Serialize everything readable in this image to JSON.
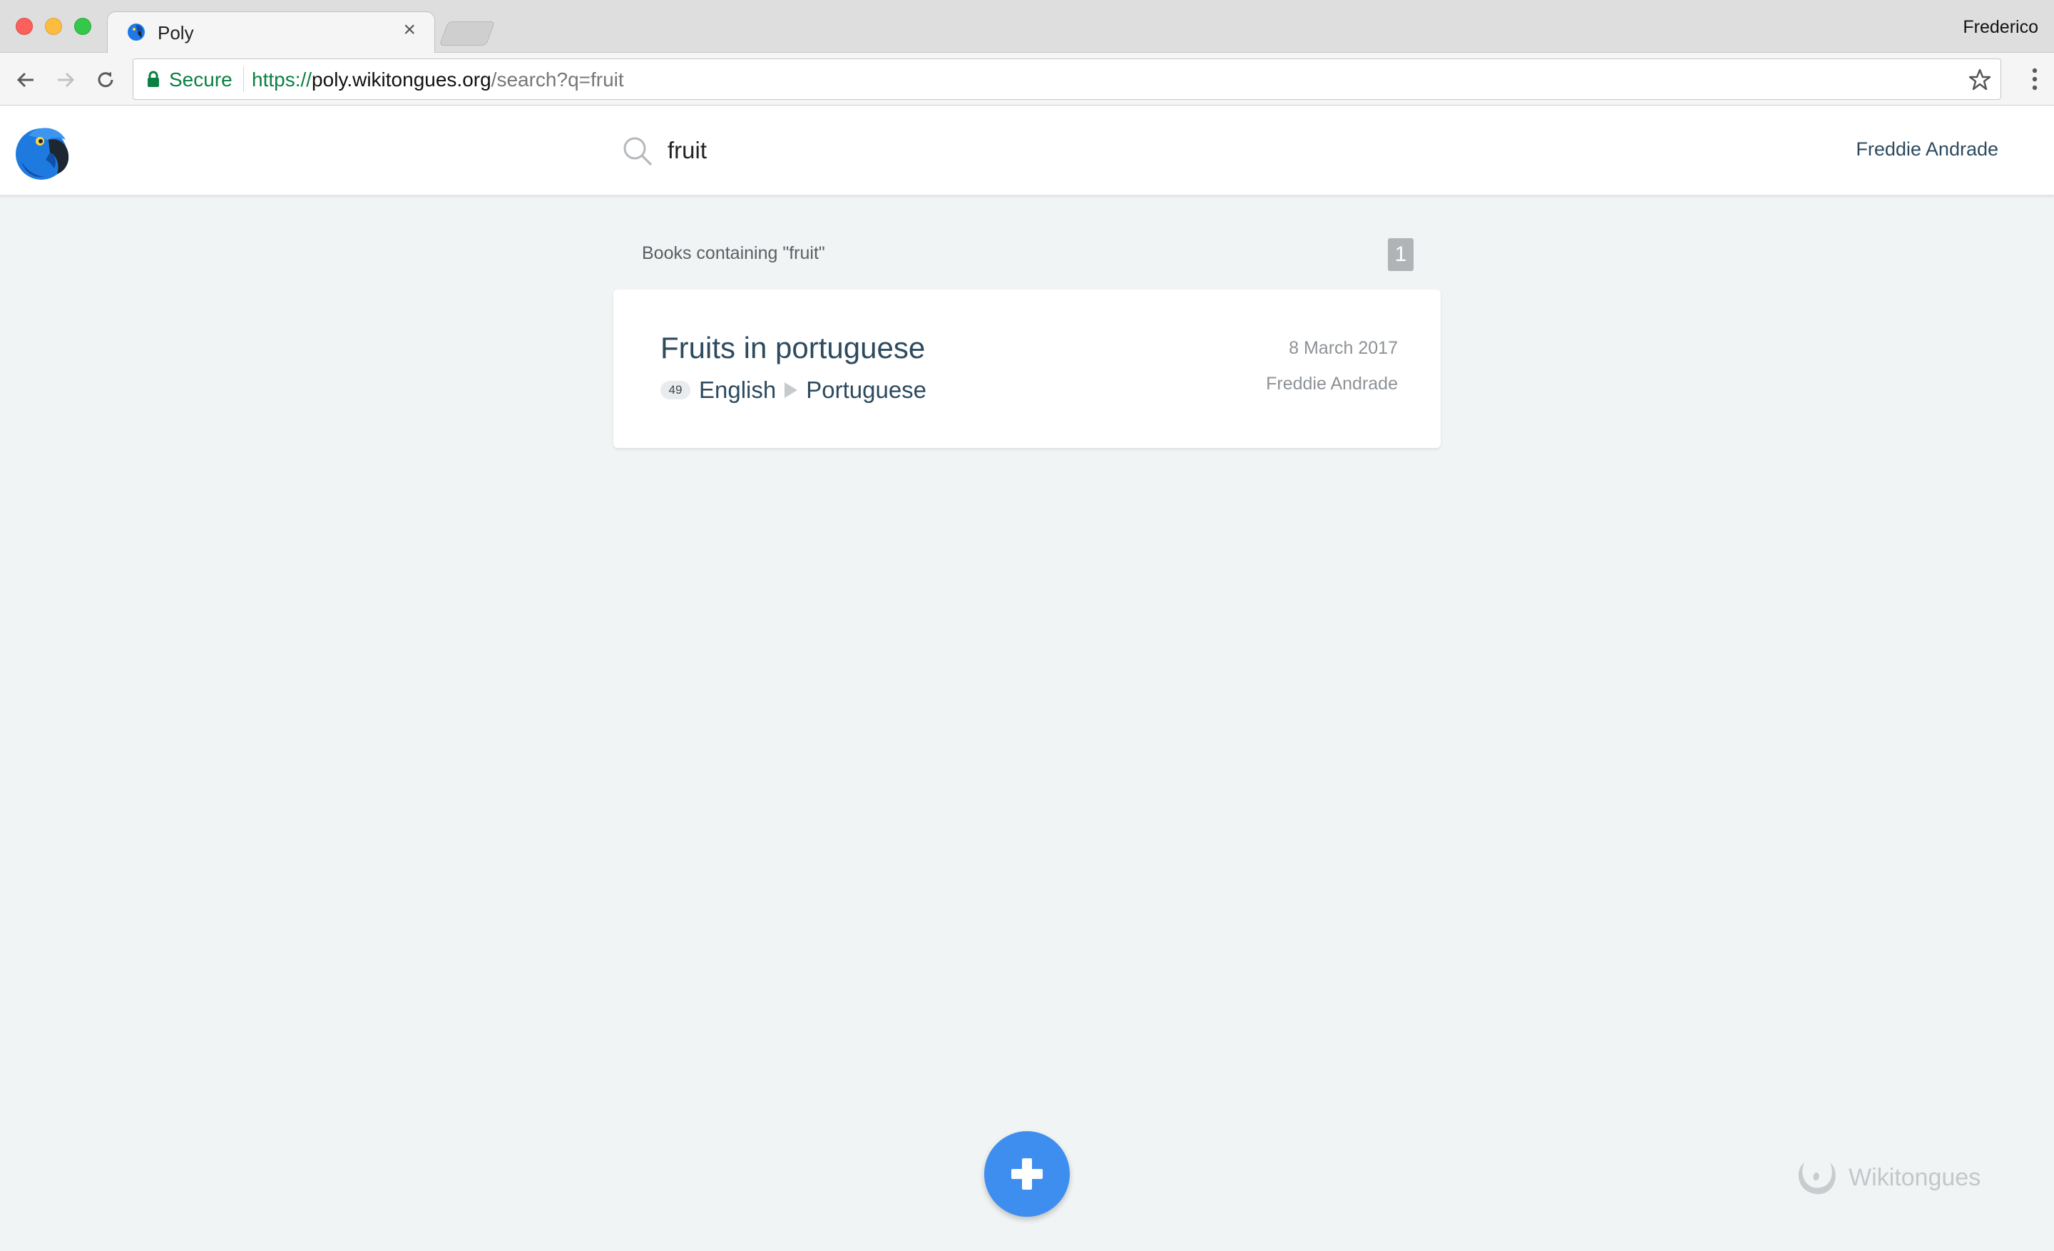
{
  "browser": {
    "tab_title": "Poly",
    "tab_close": "×",
    "profile_name": "Frederico",
    "secure_label": "Secure",
    "url_scheme": "https://",
    "url_host": "poly.wikitongues.org",
    "url_path": "/search?q=fruit"
  },
  "header": {
    "search_value": "fruit",
    "user_name": "Freddie Andrade"
  },
  "results": {
    "heading": "Books containing \"fruit\"",
    "count": "1",
    "items": [
      {
        "title": "Fruits in portuguese",
        "phrase_count": "49",
        "source_language": "English",
        "target_language": "Portuguese",
        "date": "8 March 2017",
        "author": "Freddie Andrade"
      }
    ]
  },
  "footer": {
    "brand": "Wikitongues"
  },
  "colors": {
    "accent": "#3e8ef0",
    "title_text": "#2d4a5f",
    "page_bg": "#f1f4f5",
    "secure_green": "#0b8043"
  }
}
